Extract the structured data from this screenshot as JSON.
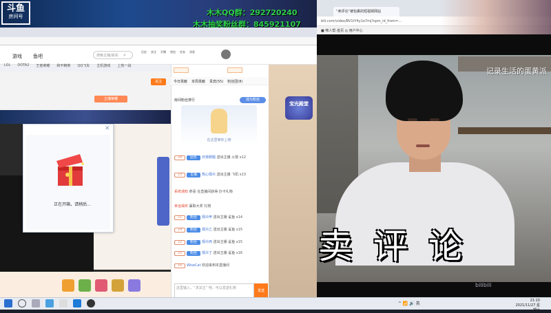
{
  "overlay": {
    "qq_line": "木木QQ群：292720240",
    "fan_line": "木木抽奖粉丝群：845921107",
    "logo_main": "斗鱼",
    "logo_sub": "房间号"
  },
  "left_browser": {
    "nav": [
      "游戏",
      "鱼吧"
    ],
    "search_placeholder": "搜索主播/房间",
    "header_icons": [
      "历史",
      "关注",
      "开播",
      "钱包",
      "任务",
      "消息"
    ],
    "sub_nav": [
      "LOL",
      "DOTA2",
      "王者荣耀",
      "和平精英",
      "QQ飞车",
      "主机游戏",
      "上热一战",
      "下一场的精彩对决"
    ],
    "follow_button": "关注",
    "room_badge": "主播荣耀"
  },
  "dialog": {
    "status_text": "正在开箱，请稍后..."
  },
  "rank_panel": {
    "tabs": [
      "今日贡献",
      "本周贡献",
      "贵宾(55)",
      "粉丝团(8)"
    ],
    "header": "房间粉丝排行",
    "card_caption": "在这里等你上榜",
    "pill": "成为粉丝"
  },
  "chat": [
    {
      "level": "28",
      "badge": "团长",
      "name": "日常刷题",
      "msg": "送出主播 火箭 x12"
    },
    {
      "level": "23",
      "badge": "主播",
      "name": "热心观众",
      "msg": "送出主播 飞机 x13"
    },
    {
      "level": "",
      "badge": "",
      "name": "系统通知",
      "msg": "恭喜 在直播间获得 办卡礼物"
    },
    {
      "level": "",
      "badge": "",
      "name": "幸运抽奖",
      "msg": "赢取大奖 礼物"
    },
    {
      "level": "21",
      "badge": "粉丝",
      "name": "观众甲",
      "msg": "送出主播 鲨鱼 x14"
    },
    {
      "level": "24",
      "badge": "粉丝",
      "name": "观众乙",
      "msg": "送出主播 鲨鱼 x15"
    },
    {
      "level": "22",
      "badge": "粉丝",
      "name": "观众丙",
      "msg": "送出主播 鲨鱼 x15"
    },
    {
      "level": "25",
      "badge": "粉丝",
      "name": "观众丁",
      "msg": "送出主播 鲨鱼 x16"
    },
    {
      "level": "16",
      "badge": "",
      "name": "WiseCat",
      "msg": "欢迎来到本直播间"
    }
  ],
  "chat_input": {
    "placeholder": "这里输入，“求关注” 吧，可以发送礼物",
    "send_label": "发送"
  },
  "side_badge": "宝光殿堂",
  "right_browser": {
    "active_tab": "“卖评论”被包裹的短视频网站",
    "address": "bili.com/video/BV1tY4y1e7mj?spm_id_from=...",
    "bookmark": "■ 唯人帮-首页 ◎ 用户中心"
  },
  "video": {
    "corner_caption": "记录生活的蛋黄派",
    "subtitle": "卖评论",
    "watermark": "bilibili"
  },
  "taskbar": {
    "time": "21:10",
    "date": "2021/11/27 星期六",
    "tray": "^ 📶 🔊 英"
  }
}
